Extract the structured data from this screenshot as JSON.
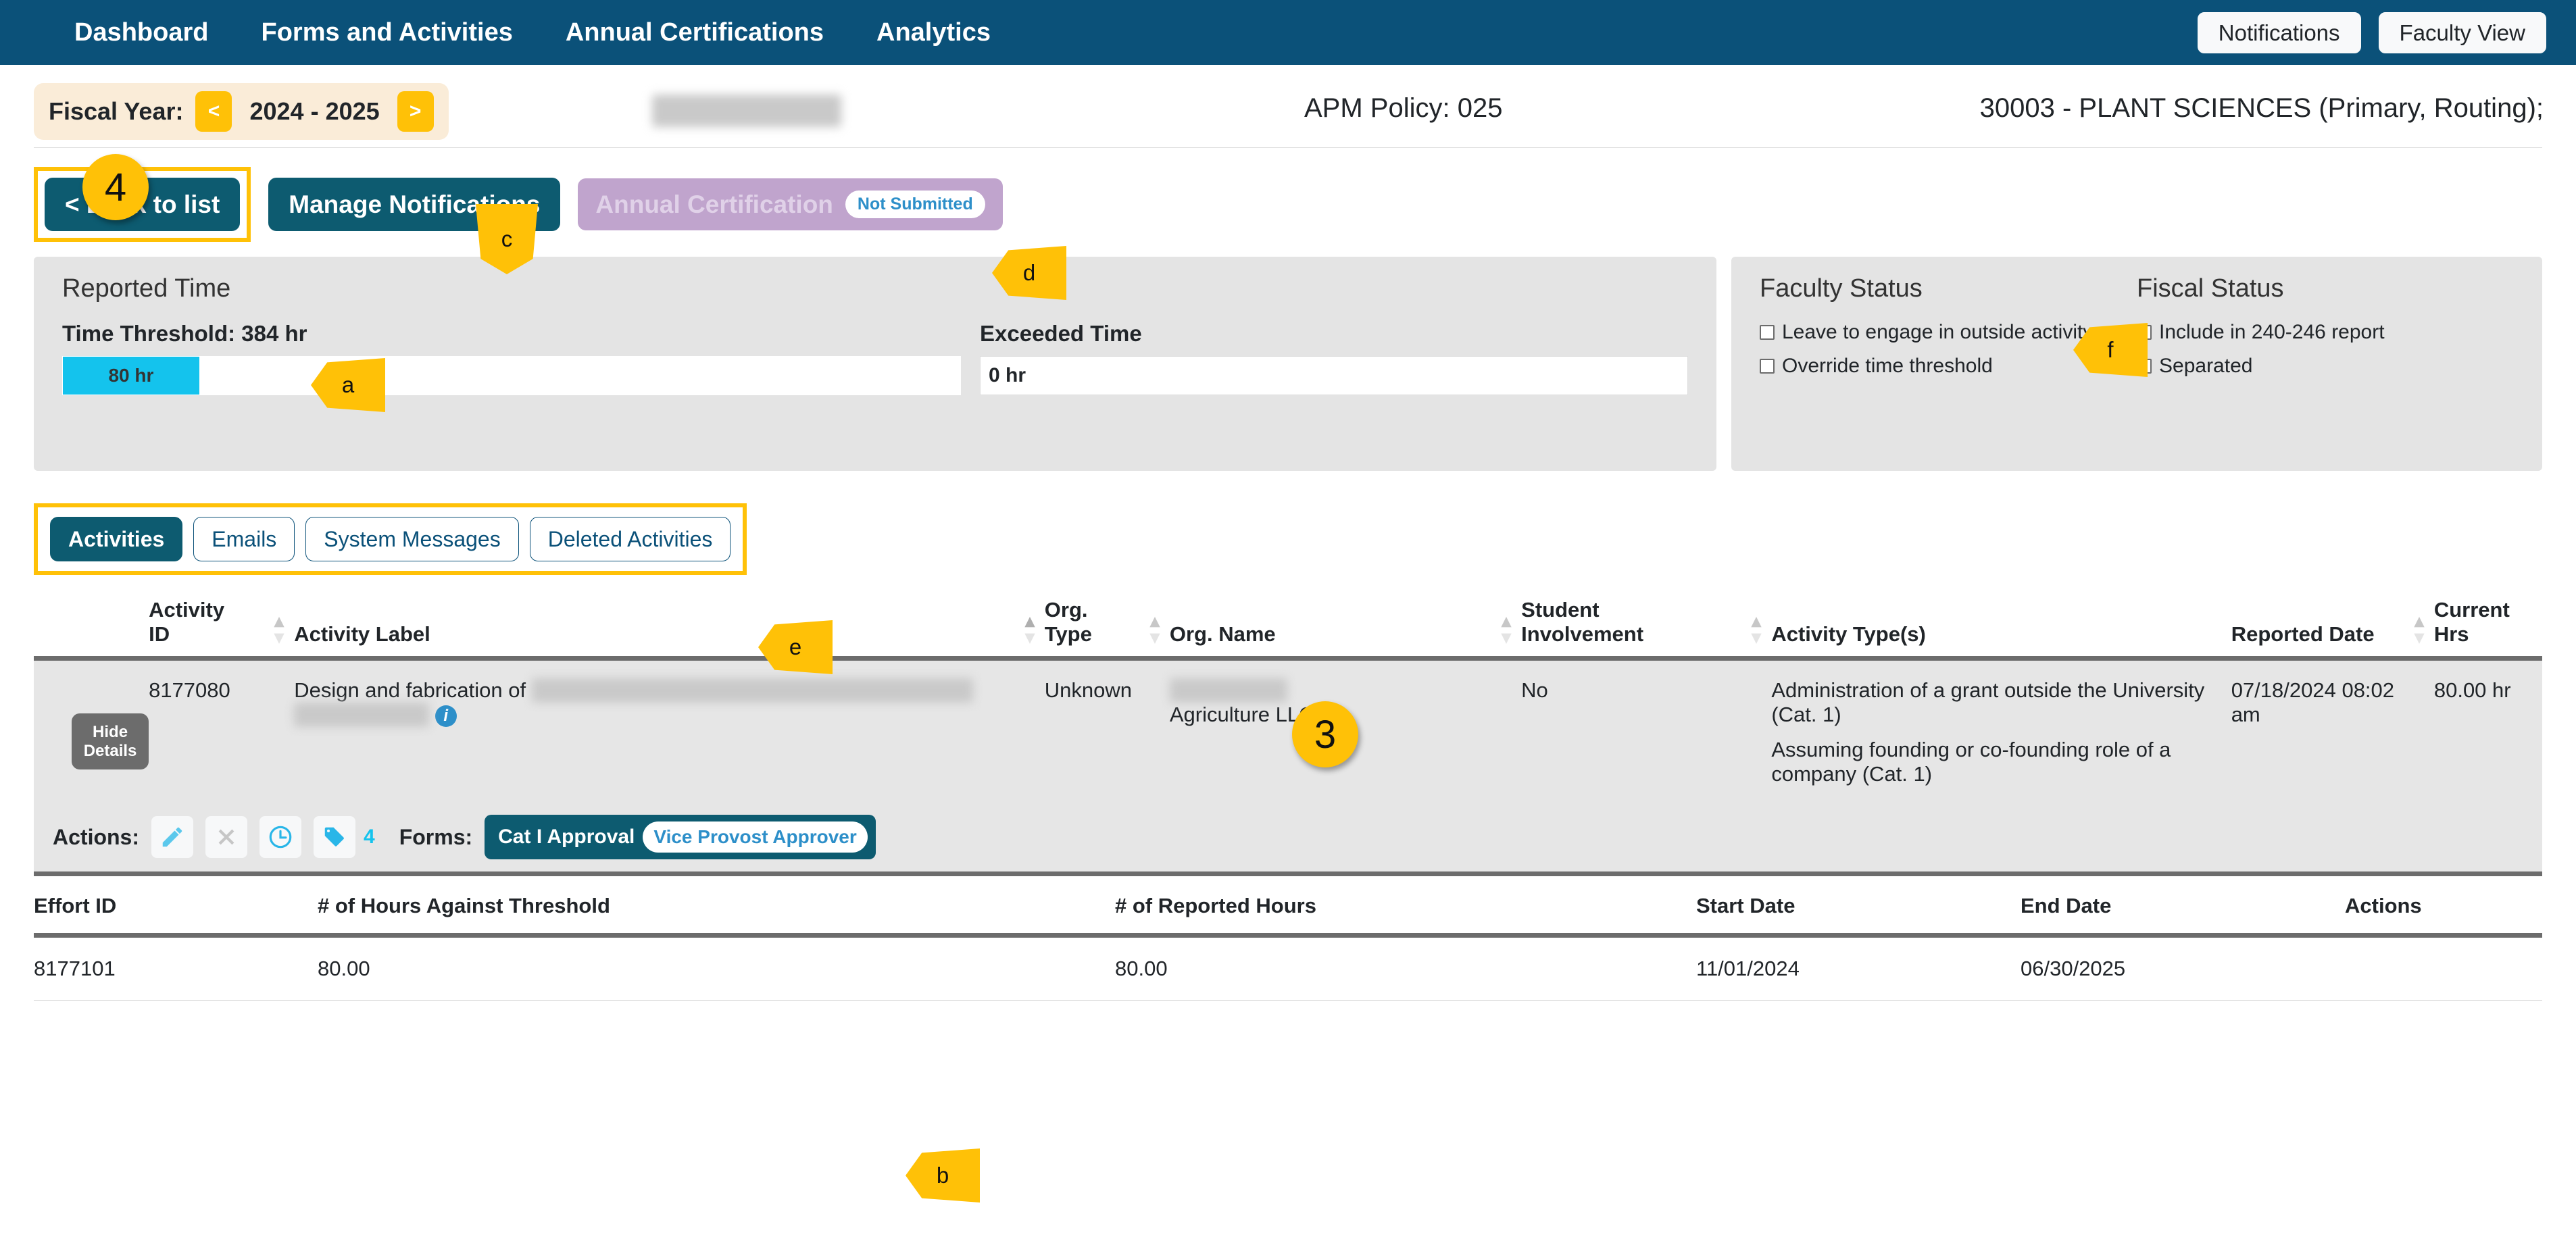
{
  "topnav": {
    "items": [
      {
        "label": "Dashboard"
      },
      {
        "label": "Forms and Activities"
      },
      {
        "label": "Annual Certifications"
      },
      {
        "label": "Analytics"
      }
    ],
    "notifications_label": "Notifications",
    "faculty_view_label": "Faculty View",
    "background_color": "#0b5179"
  },
  "header": {
    "fiscal_year_label": "Fiscal Year:",
    "fiscal_year_prev": "<",
    "fiscal_year_value": "2024 - 2025",
    "fiscal_year_next": ">",
    "faculty_name": "redacted name",
    "apm_policy": "APM Policy: 025",
    "org_assignment": "30003 - PLANT SCIENCES (Primary, Routing);"
  },
  "actions_bar": {
    "back_to_list": "< Back to list",
    "manage_notifications": "Manage Notifications",
    "annual_certification": "Annual Certification",
    "annual_certification_status": "Not Submitted"
  },
  "reported_time": {
    "title": "Reported Time",
    "threshold_label": "Time Threshold: 384 hr",
    "bar_value": "80 hr",
    "bar_color": "#14c3ed",
    "exceeded_label": "Exceeded Time",
    "exceeded_value": "0 hr"
  },
  "status_panel": {
    "faculty_status_title": "Faculty Status",
    "faculty_items": [
      {
        "label": "Leave to engage in outside activity",
        "checked": false
      },
      {
        "label": "Override time threshold",
        "checked": false
      }
    ],
    "fiscal_status_title": "Fiscal Status",
    "fiscal_items": [
      {
        "label": "Include in 240-246 report",
        "checked": false
      },
      {
        "label": "Separated",
        "checked": false
      }
    ]
  },
  "tabs": [
    {
      "label": "Activities",
      "active": true
    },
    {
      "label": "Emails",
      "active": false
    },
    {
      "label": "System Messages",
      "active": false
    },
    {
      "label": "Deleted Activities",
      "active": false
    }
  ],
  "activities_table": {
    "columns": [
      "Activity ID",
      "Activity Label",
      "Org. Type",
      "Org. Name",
      "Student Involvement",
      "Activity Type(s)",
      "Reported Date",
      "Current Hrs"
    ],
    "column_lines": {
      "activity_id": [
        "Activity",
        "ID"
      ],
      "org_type": [
        "Org.",
        "Type"
      ],
      "org_name": [
        "",
        "Org. Name"
      ],
      "student_involvement": [
        "Student",
        "Involvement"
      ],
      "activity_label": [
        "",
        "Activity Label"
      ],
      "activity_types": [
        "",
        "Activity Type(s)"
      ],
      "reported_date": [
        "",
        "Reported Date"
      ],
      "current_hrs": [
        "Current",
        "Hrs"
      ]
    },
    "rows": [
      {
        "hide_details_label": "Hide Details",
        "activity_id": "8177080",
        "activity_label_prefix": "Design and fabrication of",
        "activity_label_redacted": "redacted activity description text here continues",
        "activity_label_redacted2": "redacted more",
        "org_type": "Unknown",
        "org_name_redacted": "redacted org",
        "org_name_suffix": "Agriculture LLC",
        "student_involvement": "No",
        "activity_types": [
          "Administration of a grant outside the University (Cat. 1)",
          "Assuming founding or co-founding role of a company (Cat. 1)"
        ],
        "reported_date": "07/18/2024 08:02 am",
        "current_hrs": "80.00 hr"
      }
    ],
    "actions_strip": {
      "actions_label": "Actions:",
      "icons": [
        {
          "name": "edit-pencil-icon",
          "enabled": true
        },
        {
          "name": "delete-x-icon",
          "enabled": false
        },
        {
          "name": "history-clock-icon",
          "enabled": true
        },
        {
          "name": "tag-icon",
          "enabled": true
        }
      ],
      "tag_count": "4",
      "forms_label": "Forms:",
      "form_chip_name": "Cat I Approval",
      "form_chip_role": "Vice Provost Approver"
    }
  },
  "effort_table": {
    "columns": [
      "Effort ID",
      "# of Hours Against Threshold",
      "# of Reported Hours",
      "Start Date",
      "End Date",
      "Actions"
    ],
    "rows": [
      {
        "effort_id": "8177101",
        "hours_against_threshold": "80.00",
        "reported_hours": "80.00",
        "start_date": "11/01/2024",
        "end_date": "06/30/2025",
        "actions": ""
      }
    ]
  },
  "callouts": [
    {
      "id": "a",
      "label": "a"
    },
    {
      "id": "b",
      "label": "b"
    },
    {
      "id": "c",
      "label": "c"
    },
    {
      "id": "d",
      "label": "d"
    },
    {
      "id": "e",
      "label": "e"
    },
    {
      "id": "f",
      "label": "f"
    },
    {
      "id": "num3",
      "label": "3"
    },
    {
      "id": "num4",
      "label": "4"
    }
  ]
}
